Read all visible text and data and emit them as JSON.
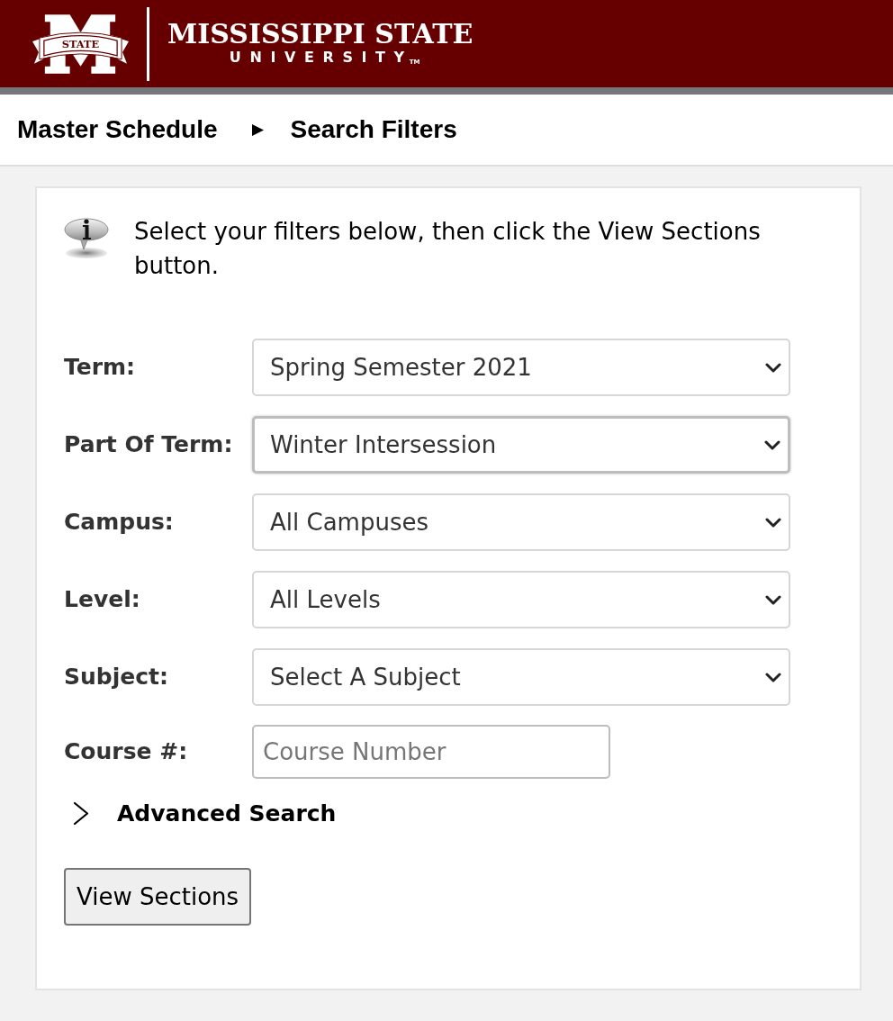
{
  "header": {
    "logo": {
      "banner_text": "STATE",
      "name": "MISSISSIPPI STATE",
      "subtitle": "UNIVERSITY",
      "trademark": "TM"
    }
  },
  "breadcrumb": [
    {
      "label": "Master Schedule"
    },
    {
      "label": "Search Filters"
    }
  ],
  "info": {
    "text": "Select your filters below, then click the View Sections button."
  },
  "fields": [
    {
      "kind": "select",
      "label": "Term:",
      "value": "Spring Semester 2021",
      "focused": false
    },
    {
      "kind": "select",
      "label": "Part Of Term:",
      "value": "Winter Intersession",
      "focused": true
    },
    {
      "kind": "select",
      "label": "Campus:",
      "value": "All Campuses",
      "focused": false
    },
    {
      "kind": "select",
      "label": "Level:",
      "value": "All Levels",
      "focused": false
    },
    {
      "kind": "select",
      "label": "Subject:",
      "value": "Select A Subject",
      "focused": false
    },
    {
      "kind": "text",
      "label": "Course #:",
      "placeholder": "Course Number"
    }
  ],
  "advanced_search": {
    "label": "Advanced Search",
    "expanded": false
  },
  "buttons": [
    {
      "label": "View Sections"
    }
  ]
}
